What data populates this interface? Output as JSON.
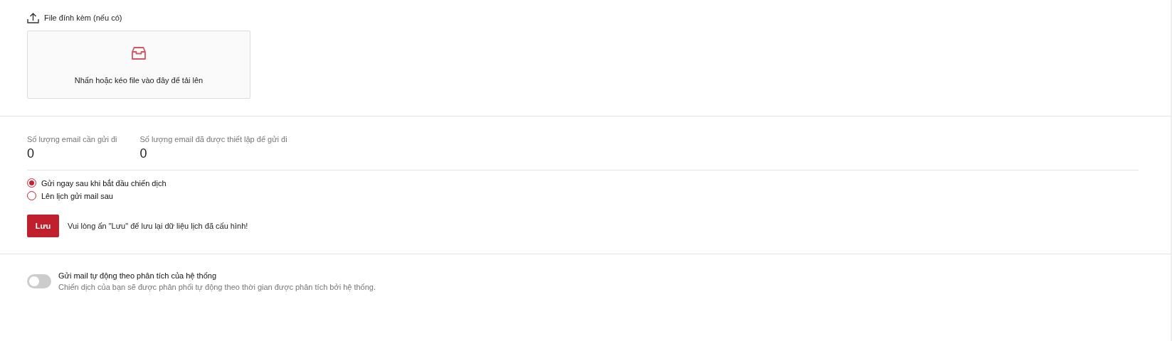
{
  "attachment": {
    "label": "File đính kèm (nếu có)",
    "dropzone_text": "Nhấn hoặc kéo file vào đây để tải lên"
  },
  "stats": [
    {
      "label": "Số lượng email cần gửi đi",
      "value": "0"
    },
    {
      "label": "Số lượng email đã được thiết lập để gửi đi",
      "value": "0"
    }
  ],
  "send_options": [
    {
      "label": "Gửi ngay sau khi bắt đầu chiến dịch",
      "selected": true
    },
    {
      "label": "Lên lịch gửi mail sau",
      "selected": false
    }
  ],
  "save": {
    "button": "Lưu",
    "note": "Vui lòng ấn \"Lưu\" để lưu lại dữ liệu lịch đã cấu hình!"
  },
  "auto_send": {
    "on": false,
    "title": "Gửi mail tự động theo phân tích của hệ thống",
    "description": "Chiến dịch của bạn sẽ được phân phối tự động theo thời gian được phân tích bởi hệ thống."
  }
}
